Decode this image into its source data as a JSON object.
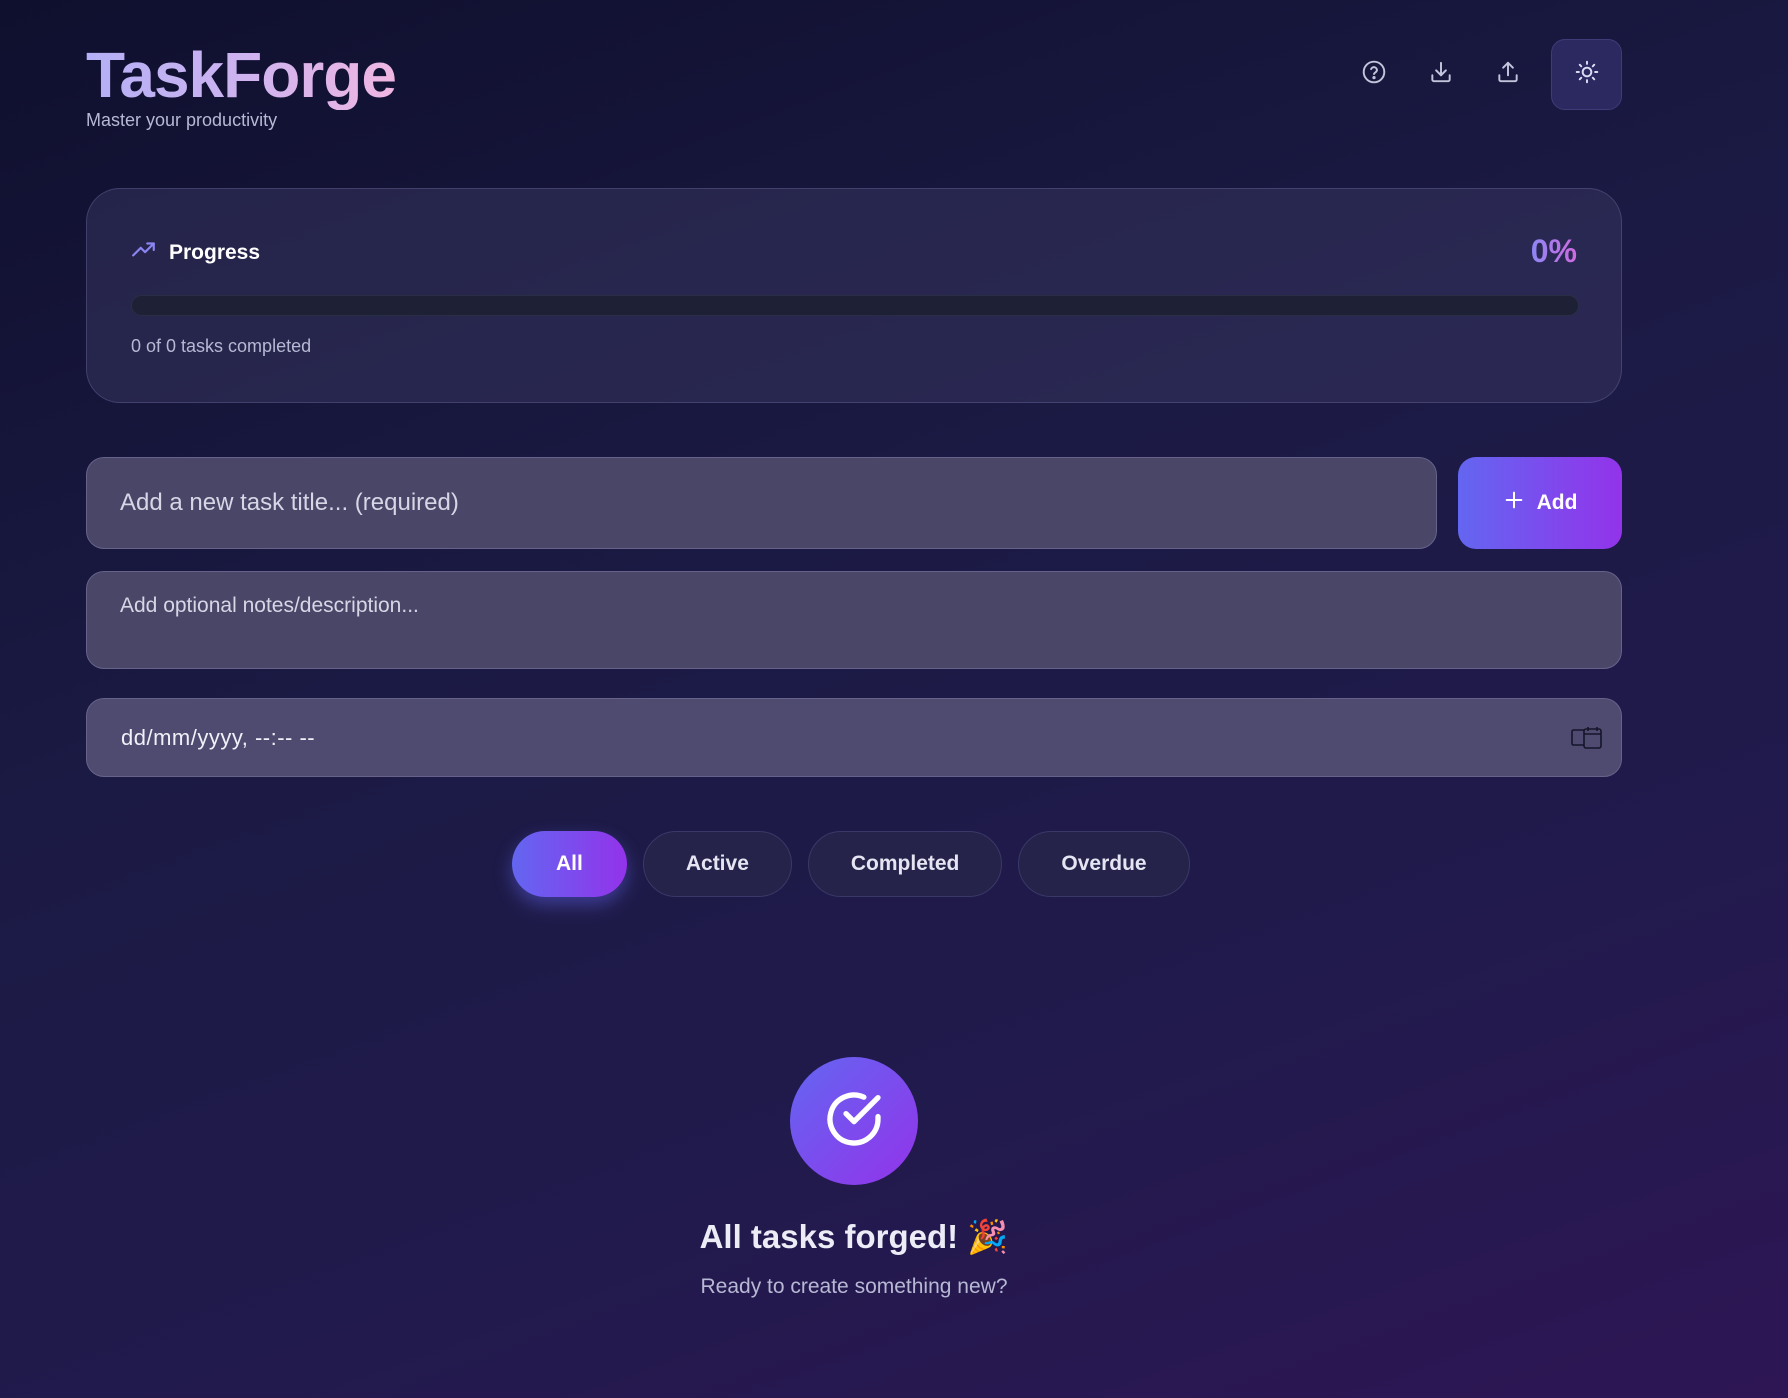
{
  "header": {
    "title": "TaskForge",
    "subtitle": "Master your productivity",
    "actions": [
      {
        "icon": "help-icon"
      },
      {
        "icon": "download-icon"
      },
      {
        "icon": "upload-icon"
      },
      {
        "icon": "sun-icon"
      }
    ]
  },
  "progress": {
    "label": "Progress",
    "percent_text": "0%",
    "fraction": 0,
    "summary": "0 of 0 tasks completed"
  },
  "form": {
    "title_placeholder": "Add a new task title... (required)",
    "title_value": "",
    "add_label": "Add",
    "notes_placeholder": "Add optional notes/description...",
    "notes_value": "",
    "date_placeholder": "dd/mm/yyyy, --:-- --"
  },
  "filters": [
    {
      "label": "All",
      "active": true
    },
    {
      "label": "Active",
      "active": false
    },
    {
      "label": "Completed",
      "active": false
    },
    {
      "label": "Overdue",
      "active": false
    }
  ],
  "empty_state": {
    "icon": "check-circle-icon",
    "title": "All tasks forged! 🎉",
    "subtitle": "Ready to create something new?"
  },
  "colors": {
    "accent_start": "#6366f1",
    "accent_end": "#9333ea",
    "background": "#1b1a44"
  }
}
